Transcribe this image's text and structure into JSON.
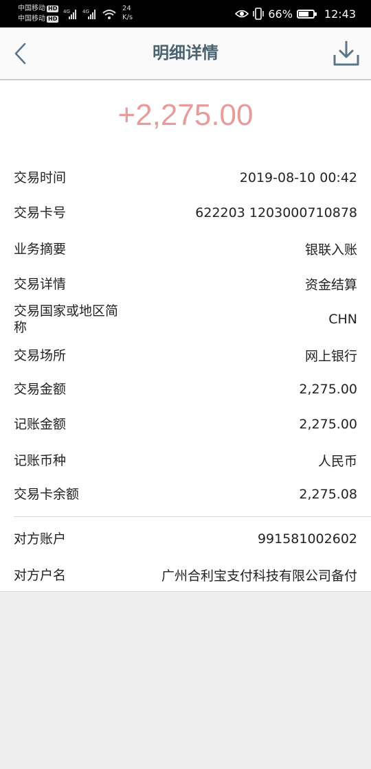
{
  "status_bar": {
    "carrier1": "中国移动",
    "carrier2": "中国移动",
    "hd": "HD",
    "net": "4G",
    "speed_value": "24",
    "speed_unit": "K/s",
    "battery": "66%",
    "battery_level": 0.66,
    "time": "12:43"
  },
  "header": {
    "title": "明细详情"
  },
  "amount": "+2,275.00",
  "details": [
    {
      "label": "交易时间",
      "value": "2019-08-10 00:42"
    },
    {
      "label": "交易卡号",
      "value": "622203 1203000710878"
    },
    {
      "label": "业务摘要",
      "value": "银联入账"
    },
    {
      "label": "交易详情",
      "value": "资金结算"
    },
    {
      "label": "交易国家或地区简称",
      "value": "CHN"
    },
    {
      "label": "交易场所",
      "value": "网上银行"
    },
    {
      "label": "交易金额",
      "value": "2,275.00"
    },
    {
      "label": "记账金额",
      "value": "2,275.00"
    },
    {
      "label": "记账币种",
      "value": "人民币"
    },
    {
      "label": "交易卡余额",
      "value": "2,275.08"
    }
  ],
  "counterparty": [
    {
      "label": "对方账户",
      "value": "991581002602"
    },
    {
      "label": "对方户名",
      "value": "广州合利宝支付科技有限公司备付"
    }
  ],
  "colors": {
    "amount": "#e89b9b",
    "title": "#4a6272",
    "icon": "#5c7585"
  }
}
